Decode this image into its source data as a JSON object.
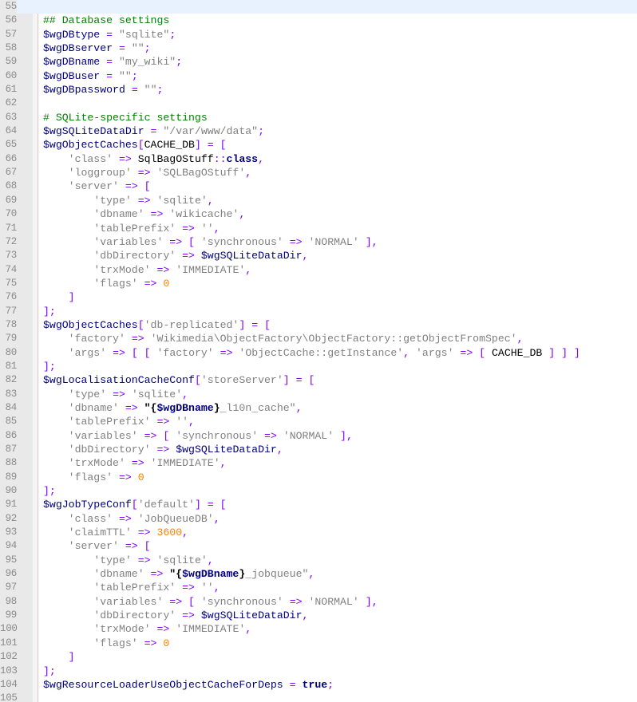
{
  "editor": {
    "line_numbers": [
      "55",
      "56",
      "57",
      "58",
      "59",
      "60",
      "61",
      "62",
      "63",
      "64",
      "65",
      "66",
      "67",
      "68",
      "69",
      "70",
      "71",
      "72",
      "73",
      "74",
      "75",
      "76",
      "77",
      "78",
      "79",
      "80",
      "81",
      "82",
      "83",
      "84",
      "85",
      "86",
      "87",
      "88",
      "89",
      "90",
      "91",
      "92",
      "93",
      "94",
      "95",
      "96",
      "97",
      "98",
      "99",
      "100",
      "101",
      "102",
      "103",
      "104",
      "105"
    ],
    "current_line_index": 0,
    "lines": [
      [],
      [
        [
          "cm",
          "## Database settings"
        ]
      ],
      [
        [
          "var",
          "$wgDBtype"
        ],
        [
          "id",
          " "
        ],
        [
          "op",
          "="
        ],
        [
          "id",
          " "
        ],
        [
          "str",
          "\"sqlite\""
        ],
        [
          "op",
          ";"
        ]
      ],
      [
        [
          "var",
          "$wgDBserver"
        ],
        [
          "id",
          " "
        ],
        [
          "op",
          "="
        ],
        [
          "id",
          " "
        ],
        [
          "str",
          "\"\""
        ],
        [
          "op",
          ";"
        ]
      ],
      [
        [
          "var",
          "$wgDBname"
        ],
        [
          "id",
          " "
        ],
        [
          "op",
          "="
        ],
        [
          "id",
          " "
        ],
        [
          "str",
          "\"my_wiki\""
        ],
        [
          "op",
          ";"
        ]
      ],
      [
        [
          "var",
          "$wgDBuser"
        ],
        [
          "id",
          " "
        ],
        [
          "op",
          "="
        ],
        [
          "id",
          " "
        ],
        [
          "str",
          "\"\""
        ],
        [
          "op",
          ";"
        ]
      ],
      [
        [
          "var",
          "$wgDBpassword"
        ],
        [
          "id",
          " "
        ],
        [
          "op",
          "="
        ],
        [
          "id",
          " "
        ],
        [
          "str",
          "\"\""
        ],
        [
          "op",
          ";"
        ]
      ],
      [],
      [
        [
          "cm",
          "# SQLite-specific settings"
        ]
      ],
      [
        [
          "var",
          "$wgSQLiteDataDir"
        ],
        [
          "id",
          " "
        ],
        [
          "op",
          "="
        ],
        [
          "id",
          " "
        ],
        [
          "str",
          "\"/var/www/data\""
        ],
        [
          "op",
          ";"
        ]
      ],
      [
        [
          "var",
          "$wgObjectCaches"
        ],
        [
          "op",
          "["
        ],
        [
          "id",
          "CACHE_DB"
        ],
        [
          "op",
          "]"
        ],
        [
          "id",
          " "
        ],
        [
          "op",
          "="
        ],
        [
          "id",
          " "
        ],
        [
          "op",
          "["
        ]
      ],
      [
        [
          "id",
          "    "
        ],
        [
          "str",
          "'class'"
        ],
        [
          "id",
          " "
        ],
        [
          "op",
          "=>"
        ],
        [
          "id",
          " SqlBagOStuff"
        ],
        [
          "op",
          "::"
        ],
        [
          "kw",
          "class"
        ],
        [
          "op",
          ","
        ]
      ],
      [
        [
          "id",
          "    "
        ],
        [
          "str",
          "'loggroup'"
        ],
        [
          "id",
          " "
        ],
        [
          "op",
          "=>"
        ],
        [
          "id",
          " "
        ],
        [
          "str",
          "'SQLBagOStuff'"
        ],
        [
          "op",
          ","
        ]
      ],
      [
        [
          "id",
          "    "
        ],
        [
          "str",
          "'server'"
        ],
        [
          "id",
          " "
        ],
        [
          "op",
          "=>"
        ],
        [
          "id",
          " "
        ],
        [
          "op",
          "["
        ]
      ],
      [
        [
          "id",
          "        "
        ],
        [
          "str",
          "'type'"
        ],
        [
          "id",
          " "
        ],
        [
          "op",
          "=>"
        ],
        [
          "id",
          " "
        ],
        [
          "str",
          "'sqlite'"
        ],
        [
          "op",
          ","
        ]
      ],
      [
        [
          "id",
          "        "
        ],
        [
          "str",
          "'dbname'"
        ],
        [
          "id",
          " "
        ],
        [
          "op",
          "=>"
        ],
        [
          "id",
          " "
        ],
        [
          "str",
          "'wikicache'"
        ],
        [
          "op",
          ","
        ]
      ],
      [
        [
          "id",
          "        "
        ],
        [
          "str",
          "'tablePrefix'"
        ],
        [
          "id",
          " "
        ],
        [
          "op",
          "=>"
        ],
        [
          "id",
          " "
        ],
        [
          "str",
          "''"
        ],
        [
          "op",
          ","
        ]
      ],
      [
        [
          "id",
          "        "
        ],
        [
          "str",
          "'variables'"
        ],
        [
          "id",
          " "
        ],
        [
          "op",
          "=>"
        ],
        [
          "id",
          " "
        ],
        [
          "op",
          "["
        ],
        [
          "id",
          " "
        ],
        [
          "str",
          "'synchronous'"
        ],
        [
          "id",
          " "
        ],
        [
          "op",
          "=>"
        ],
        [
          "id",
          " "
        ],
        [
          "str",
          "'NORMAL'"
        ],
        [
          "id",
          " "
        ],
        [
          "op",
          "],"
        ]
      ],
      [
        [
          "id",
          "        "
        ],
        [
          "str",
          "'dbDirectory'"
        ],
        [
          "id",
          " "
        ],
        [
          "op",
          "=>"
        ],
        [
          "id",
          " "
        ],
        [
          "var",
          "$wgSQLiteDataDir"
        ],
        [
          "op",
          ","
        ]
      ],
      [
        [
          "id",
          "        "
        ],
        [
          "str",
          "'trxMode'"
        ],
        [
          "id",
          " "
        ],
        [
          "op",
          "=>"
        ],
        [
          "id",
          " "
        ],
        [
          "str",
          "'IMMEDIATE'"
        ],
        [
          "op",
          ","
        ]
      ],
      [
        [
          "id",
          "        "
        ],
        [
          "str",
          "'flags'"
        ],
        [
          "id",
          " "
        ],
        [
          "op",
          "=>"
        ],
        [
          "id",
          " "
        ],
        [
          "num",
          "0"
        ]
      ],
      [
        [
          "id",
          "    "
        ],
        [
          "op",
          "]"
        ]
      ],
      [
        [
          "op",
          "];"
        ]
      ],
      [
        [
          "var",
          "$wgObjectCaches"
        ],
        [
          "op",
          "["
        ],
        [
          "str",
          "'db-replicated'"
        ],
        [
          "op",
          "]"
        ],
        [
          "id",
          " "
        ],
        [
          "op",
          "="
        ],
        [
          "id",
          " "
        ],
        [
          "op",
          "["
        ]
      ],
      [
        [
          "id",
          "    "
        ],
        [
          "str",
          "'factory'"
        ],
        [
          "id",
          " "
        ],
        [
          "op",
          "=>"
        ],
        [
          "id",
          " "
        ],
        [
          "str",
          "'Wikimedia\\ObjectFactory\\ObjectFactory::getObjectFromSpec'"
        ],
        [
          "op",
          ","
        ]
      ],
      [
        [
          "id",
          "    "
        ],
        [
          "str",
          "'args'"
        ],
        [
          "id",
          " "
        ],
        [
          "op",
          "=>"
        ],
        [
          "id",
          " "
        ],
        [
          "op",
          "["
        ],
        [
          "id",
          " "
        ],
        [
          "op",
          "["
        ],
        [
          "id",
          " "
        ],
        [
          "str",
          "'factory'"
        ],
        [
          "id",
          " "
        ],
        [
          "op",
          "=>"
        ],
        [
          "id",
          " "
        ],
        [
          "str",
          "'ObjectCache::getInstance'"
        ],
        [
          "op",
          ","
        ],
        [
          "id",
          " "
        ],
        [
          "str",
          "'args'"
        ],
        [
          "id",
          " "
        ],
        [
          "op",
          "=>"
        ],
        [
          "id",
          " "
        ],
        [
          "op",
          "["
        ],
        [
          "id",
          " CACHE_DB "
        ],
        [
          "op",
          "]"
        ],
        [
          "id",
          " "
        ],
        [
          "op",
          "]"
        ],
        [
          "id",
          " "
        ],
        [
          "op",
          "]"
        ]
      ],
      [
        [
          "op",
          "];"
        ]
      ],
      [
        [
          "var",
          "$wgLocalisationCacheConf"
        ],
        [
          "op",
          "["
        ],
        [
          "str",
          "'storeServer'"
        ],
        [
          "op",
          "]"
        ],
        [
          "id",
          " "
        ],
        [
          "op",
          "="
        ],
        [
          "id",
          " "
        ],
        [
          "op",
          "["
        ]
      ],
      [
        [
          "id",
          "    "
        ],
        [
          "str",
          "'type'"
        ],
        [
          "id",
          " "
        ],
        [
          "op",
          "=>"
        ],
        [
          "id",
          " "
        ],
        [
          "str",
          "'sqlite'"
        ],
        [
          "op",
          ","
        ]
      ],
      [
        [
          "id",
          "    "
        ],
        [
          "str",
          "'dbname'"
        ],
        [
          "id",
          " "
        ],
        [
          "op",
          "=>"
        ],
        [
          "id",
          " "
        ],
        [
          "strb",
          "\"{"
        ],
        [
          "bvar",
          "$wgDBname"
        ],
        [
          "strb",
          "}"
        ],
        [
          "str",
          "_l10n_cache\""
        ],
        [
          "op",
          ","
        ]
      ],
      [
        [
          "id",
          "    "
        ],
        [
          "str",
          "'tablePrefix'"
        ],
        [
          "id",
          " "
        ],
        [
          "op",
          "=>"
        ],
        [
          "id",
          " "
        ],
        [
          "str",
          "''"
        ],
        [
          "op",
          ","
        ]
      ],
      [
        [
          "id",
          "    "
        ],
        [
          "str",
          "'variables'"
        ],
        [
          "id",
          " "
        ],
        [
          "op",
          "=>"
        ],
        [
          "id",
          " "
        ],
        [
          "op",
          "["
        ],
        [
          "id",
          " "
        ],
        [
          "str",
          "'synchronous'"
        ],
        [
          "id",
          " "
        ],
        [
          "op",
          "=>"
        ],
        [
          "id",
          " "
        ],
        [
          "str",
          "'NORMAL'"
        ],
        [
          "id",
          " "
        ],
        [
          "op",
          "],"
        ]
      ],
      [
        [
          "id",
          "    "
        ],
        [
          "str",
          "'dbDirectory'"
        ],
        [
          "id",
          " "
        ],
        [
          "op",
          "=>"
        ],
        [
          "id",
          " "
        ],
        [
          "var",
          "$wgSQLiteDataDir"
        ],
        [
          "op",
          ","
        ]
      ],
      [
        [
          "id",
          "    "
        ],
        [
          "str",
          "'trxMode'"
        ],
        [
          "id",
          " "
        ],
        [
          "op",
          "=>"
        ],
        [
          "id",
          " "
        ],
        [
          "str",
          "'IMMEDIATE'"
        ],
        [
          "op",
          ","
        ]
      ],
      [
        [
          "id",
          "    "
        ],
        [
          "str",
          "'flags'"
        ],
        [
          "id",
          " "
        ],
        [
          "op",
          "=>"
        ],
        [
          "id",
          " "
        ],
        [
          "num",
          "0"
        ]
      ],
      [
        [
          "op",
          "];"
        ]
      ],
      [
        [
          "var",
          "$wgJobTypeConf"
        ],
        [
          "op",
          "["
        ],
        [
          "str",
          "'default'"
        ],
        [
          "op",
          "]"
        ],
        [
          "id",
          " "
        ],
        [
          "op",
          "="
        ],
        [
          "id",
          " "
        ],
        [
          "op",
          "["
        ]
      ],
      [
        [
          "id",
          "    "
        ],
        [
          "str",
          "'class'"
        ],
        [
          "id",
          " "
        ],
        [
          "op",
          "=>"
        ],
        [
          "id",
          " "
        ],
        [
          "str",
          "'JobQueueDB'"
        ],
        [
          "op",
          ","
        ]
      ],
      [
        [
          "id",
          "    "
        ],
        [
          "str",
          "'claimTTL'"
        ],
        [
          "id",
          " "
        ],
        [
          "op",
          "=>"
        ],
        [
          "id",
          " "
        ],
        [
          "num",
          "3600"
        ],
        [
          "op",
          ","
        ]
      ],
      [
        [
          "id",
          "    "
        ],
        [
          "str",
          "'server'"
        ],
        [
          "id",
          " "
        ],
        [
          "op",
          "=>"
        ],
        [
          "id",
          " "
        ],
        [
          "op",
          "["
        ]
      ],
      [
        [
          "id",
          "        "
        ],
        [
          "str",
          "'type'"
        ],
        [
          "id",
          " "
        ],
        [
          "op",
          "=>"
        ],
        [
          "id",
          " "
        ],
        [
          "str",
          "'sqlite'"
        ],
        [
          "op",
          ","
        ]
      ],
      [
        [
          "id",
          "        "
        ],
        [
          "str",
          "'dbname'"
        ],
        [
          "id",
          " "
        ],
        [
          "op",
          "=>"
        ],
        [
          "id",
          " "
        ],
        [
          "strb",
          "\"{"
        ],
        [
          "bvar",
          "$wgDBname"
        ],
        [
          "strb",
          "}"
        ],
        [
          "str",
          "_jobqueue\""
        ],
        [
          "op",
          ","
        ]
      ],
      [
        [
          "id",
          "        "
        ],
        [
          "str",
          "'tablePrefix'"
        ],
        [
          "id",
          " "
        ],
        [
          "op",
          "=>"
        ],
        [
          "id",
          " "
        ],
        [
          "str",
          "''"
        ],
        [
          "op",
          ","
        ]
      ],
      [
        [
          "id",
          "        "
        ],
        [
          "str",
          "'variables'"
        ],
        [
          "id",
          " "
        ],
        [
          "op",
          "=>"
        ],
        [
          "id",
          " "
        ],
        [
          "op",
          "["
        ],
        [
          "id",
          " "
        ],
        [
          "str",
          "'synchronous'"
        ],
        [
          "id",
          " "
        ],
        [
          "op",
          "=>"
        ],
        [
          "id",
          " "
        ],
        [
          "str",
          "'NORMAL'"
        ],
        [
          "id",
          " "
        ],
        [
          "op",
          "],"
        ]
      ],
      [
        [
          "id",
          "        "
        ],
        [
          "str",
          "'dbDirectory'"
        ],
        [
          "id",
          " "
        ],
        [
          "op",
          "=>"
        ],
        [
          "id",
          " "
        ],
        [
          "var",
          "$wgSQLiteDataDir"
        ],
        [
          "op",
          ","
        ]
      ],
      [
        [
          "id",
          "        "
        ],
        [
          "str",
          "'trxMode'"
        ],
        [
          "id",
          " "
        ],
        [
          "op",
          "=>"
        ],
        [
          "id",
          " "
        ],
        [
          "str",
          "'IMMEDIATE'"
        ],
        [
          "op",
          ","
        ]
      ],
      [
        [
          "id",
          "        "
        ],
        [
          "str",
          "'flags'"
        ],
        [
          "id",
          " "
        ],
        [
          "op",
          "=>"
        ],
        [
          "id",
          " "
        ],
        [
          "num",
          "0"
        ]
      ],
      [
        [
          "id",
          "    "
        ],
        [
          "op",
          "]"
        ]
      ],
      [
        [
          "op",
          "];"
        ]
      ],
      [
        [
          "var",
          "$wgResourceLoaderUseObjectCacheForDeps"
        ],
        [
          "id",
          " "
        ],
        [
          "op",
          "="
        ],
        [
          "id",
          " "
        ],
        [
          "kw",
          "true"
        ],
        [
          "op",
          ";"
        ]
      ],
      []
    ]
  },
  "colors": {
    "comment": "#008000",
    "variable": "#000080",
    "string": "#808080",
    "operator": "#8000ff",
    "keyword": "#000080",
    "number": "#ff8000",
    "current_line": "#e8f2fe",
    "gutter": "#e9e9e9",
    "margin_line": "#f4b6b6"
  }
}
